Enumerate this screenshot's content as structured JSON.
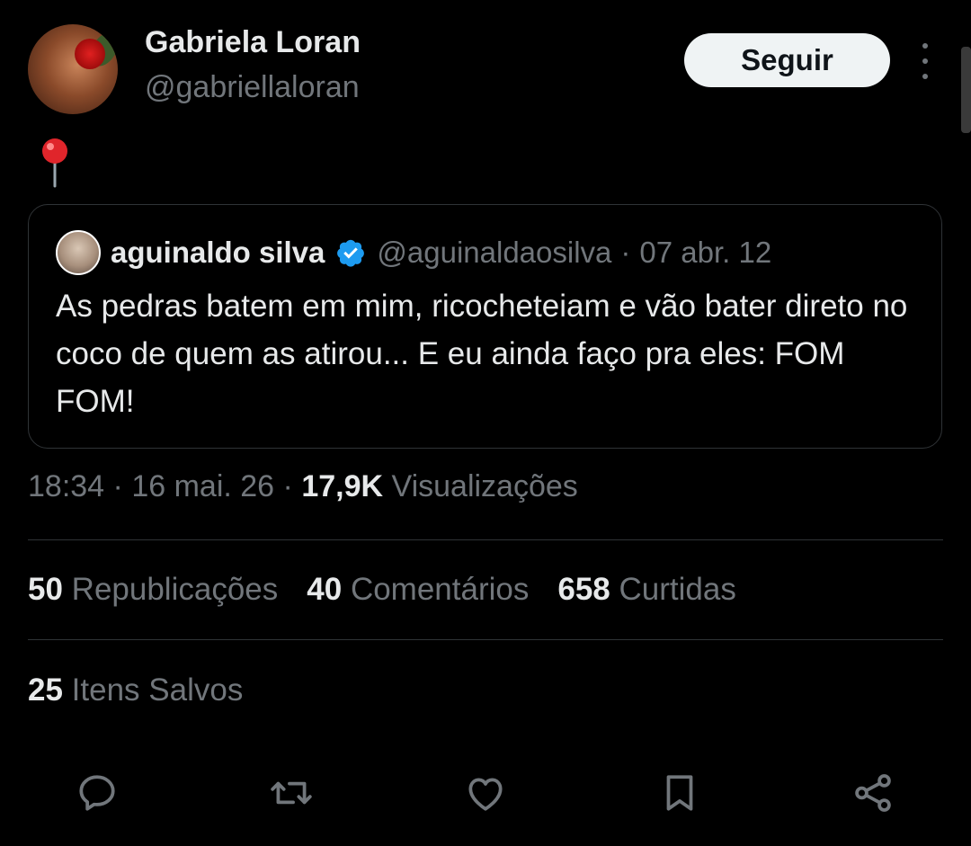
{
  "author": {
    "name": "Gabriela Loran",
    "handle": "@gabriellaloran",
    "follow_label": "Seguir"
  },
  "tweet": {
    "text_emoji": "round-pushpin"
  },
  "quoted": {
    "name": "aguinaldo silva",
    "handle": "@aguinaldaosilva",
    "separator": "·",
    "date": "07 abr. 12",
    "text": "As pedras batem em mim, ricocheteiam e vão bater direto no coco de quem as atirou... E eu ainda faço pra eles: FOM FOM!",
    "verified": true
  },
  "meta": {
    "time": "18:34",
    "sep1": "·",
    "date": "16 mai. 26",
    "sep2": "·",
    "views_count": "17,9K",
    "views_label": "Visualizações"
  },
  "stats": [
    {
      "count": "50",
      "label": "Republicações"
    },
    {
      "count": "40",
      "label": "Comentários"
    },
    {
      "count": "658",
      "label": "Curtidas"
    }
  ],
  "saved": {
    "count": "25",
    "label": "Itens Salvos"
  },
  "actions": [
    "reply-icon",
    "retweet-icon",
    "like-icon",
    "bookmark-icon",
    "share-icon"
  ],
  "colors": {
    "background": "#000000",
    "primary_text": "#e7e9ea",
    "secondary_text": "#71767b",
    "border": "#2f3336",
    "verified": "#1d9bf0"
  }
}
